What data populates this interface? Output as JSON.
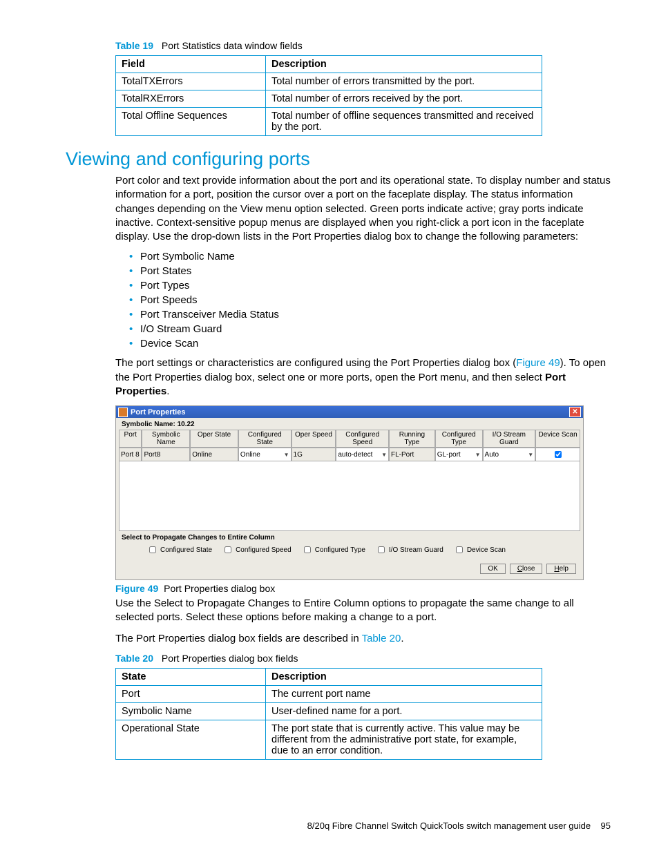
{
  "table19": {
    "caption_num": "Table 19",
    "caption_text": "Port Statistics data window fields",
    "headers": [
      "Field",
      "Description"
    ],
    "rows": [
      [
        "TotalTXErrors",
        "Total number of errors transmitted by the port."
      ],
      [
        "TotalRXErrors",
        "Total number of errors received by the port."
      ],
      [
        "Total Offline Sequences",
        "Total number of offline sequences transmitted and received by the port."
      ]
    ]
  },
  "section_heading": "Viewing and configuring ports",
  "para1": "Port color and text provide information about the port and its operational state. To display number and status information for a port, position the cursor over a port on the faceplate display. The status information changes depending on the View menu option selected. Green ports indicate active; gray ports indicate inactive. Context-sensitive popup menus are displayed when you right-click a port icon in the faceplate display. Use the drop-down lists in the Port Properties dialog box to change the following parameters:",
  "bullets": [
    "Port Symbolic Name",
    "Port States",
    "Port Types",
    "Port Speeds",
    "Port Transceiver Media Status",
    "I/O Stream Guard",
    "Device Scan"
  ],
  "para2_a": "The port settings or characteristics are configured using the Port Properties dialog box (",
  "para2_link": "Figure 49",
  "para2_b": "). To open the Port Properties dialog box, select one or more ports, open the Port menu, and then select ",
  "para2_bold": "Port Properties",
  "para2_c": ".",
  "dialog": {
    "title": "Port Properties",
    "symbolic_name_label": "Symbolic Name: 10.22",
    "columns": [
      "Port",
      "Symbolic Name",
      "Oper State",
      "Configured State",
      "Oper Speed",
      "Configured Speed",
      "Running Type",
      "Configured Type",
      "I/O Stream Guard",
      "Device Scan"
    ],
    "row": {
      "port": "Port 8",
      "symbolic": "Port8",
      "oper_state": "Online",
      "conf_state": "Online",
      "oper_speed": "1G",
      "conf_speed": "auto-detect",
      "running_type": "FL-Port",
      "conf_type": "GL-port",
      "io_guard": "Auto",
      "dev_scan_checked": true
    },
    "propagate_label": "Select to Propagate Changes to Entire Column",
    "propagate_opts": [
      "Configured State",
      "Configured Speed",
      "Configured Type",
      "I/O Stream Guard",
      "Device Scan"
    ],
    "buttons": {
      "ok": "OK",
      "close": "Close",
      "help": "Help",
      "close_u": "C",
      "help_u": "H"
    }
  },
  "fig49": {
    "num": "Figure 49",
    "text": "Port Properties dialog box"
  },
  "para3": "Use the Select to Propagate Changes to Entire Column options to propagate the same change to all selected ports. Select these options before making a change to a port.",
  "para4_a": "The Port Properties dialog box fields are described in ",
  "para4_link": "Table 20",
  "para4_b": ".",
  "table20": {
    "caption_num": "Table 20",
    "caption_text": "Port Properties dialog box fields",
    "headers": [
      "State",
      "Description"
    ],
    "rows": [
      [
        "Port",
        "The current port name"
      ],
      [
        "Symbolic Name",
        "User-defined name for a port."
      ],
      [
        "Operational State",
        "The port state that is currently active. This value may be different from the administrative port state, for example, due to an error condition."
      ]
    ]
  },
  "footer": {
    "text": "8/20q Fibre Channel Switch QuickTools switch management user guide",
    "page": "95"
  }
}
